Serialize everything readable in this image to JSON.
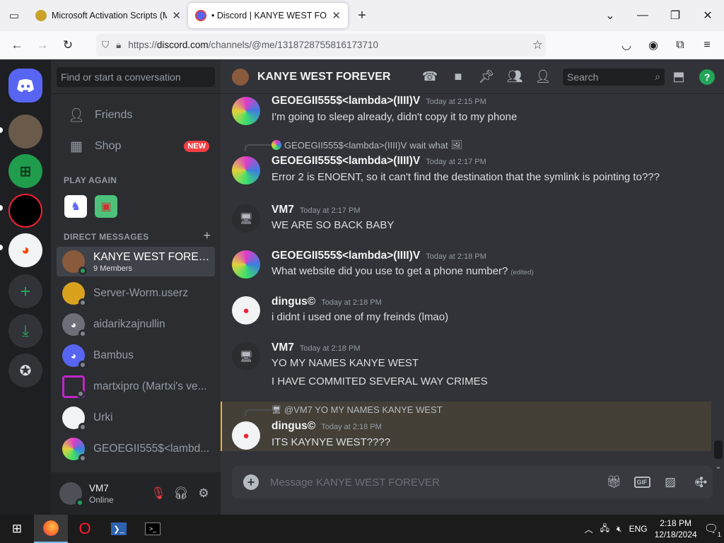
{
  "browser": {
    "tabs": [
      {
        "title": "Microsoft Activation Scripts (M",
        "active": false
      },
      {
        "title": "• Discord | KANYE WEST FOREV",
        "active": true
      }
    ],
    "new_tab": "+",
    "url_prefix": "https://",
    "url_host": "discord.com",
    "url_path": "/channels/@me/1318728755816173710"
  },
  "servers": {
    "items": [
      "discord-home",
      "avatar-1",
      "avatar-2",
      "avatar-3",
      "avatar-4"
    ],
    "add_label": "+",
    "download_label": "⤓",
    "discover_label": "⊘"
  },
  "dm_panel": {
    "search_placeholder": "Find or start a conversation",
    "friends_label": "Friends",
    "shop_label": "Shop",
    "shop_badge": "NEW",
    "play_again_label": "PLAY AGAIN",
    "direct_messages_label": "DIRECT MESSAGES",
    "add_dm": "+",
    "dms": [
      {
        "name": "KANYE WEST FOREV...",
        "sub": "9 Members",
        "selected": true,
        "status": "on",
        "color": "#8a5a3c"
      },
      {
        "name": "Server-Worm.userz",
        "sub": "",
        "selected": false,
        "status": "off",
        "color": "#d9a21e"
      },
      {
        "name": "aidarikzajnullin",
        "sub": "",
        "selected": false,
        "status": "off",
        "color": "#6d6f78"
      },
      {
        "name": "Bambus",
        "sub": "",
        "selected": false,
        "status": "off",
        "color": "#5865f2"
      },
      {
        "name": "martxipro (Martxi's ve...",
        "sub": "",
        "selected": false,
        "status": "off",
        "color": "#c026c9"
      },
      {
        "name": "Urki",
        "sub": "",
        "selected": false,
        "status": "off",
        "color": "#f2f3f5"
      },
      {
        "name": "GEOEGII555$<lambd...",
        "sub": "",
        "selected": false,
        "status": "off",
        "color": "#e03cc7"
      }
    ]
  },
  "user": {
    "name": "VM7",
    "status": "Online"
  },
  "chat": {
    "channel_name": "KANYE WEST FOREVER",
    "search_placeholder": "Search",
    "composer_placeholder": "Message KANYE WEST FOREVER",
    "messages": [
      {
        "author": "GEOEGII555$<lambda>(IIII)V",
        "time": "Today at 2:15 PM",
        "lines": [
          "I'm going to sleep already, didn't copy it to my phone"
        ]
      },
      {
        "reply_author": "GEOEGII555$<lambda>(IIII)V",
        "reply_text": "wait what",
        "author": "GEOEGII555$<lambda>(IIII)V",
        "time": "Today at 2:17 PM",
        "lines": [
          "Error 2 is ENOENT, so it can't find the destination that the symlink is pointing to???"
        ]
      },
      {
        "author": "VM7",
        "time": "Today at 2:17 PM",
        "lines": [
          "WE ARE SO BACK BABY"
        ]
      },
      {
        "author": "GEOEGII555$<lambda>(IIII)V",
        "time": "Today at 2:18 PM",
        "lines": [
          "What website did you use to get a phone number?"
        ],
        "edited": "(edited)"
      },
      {
        "author": "dingus©",
        "time": "Today at 2:18 PM",
        "lines": [
          "i didnt i used one of my freinds (lmao)"
        ]
      },
      {
        "author": "VM7",
        "time": "Today at 2:18 PM",
        "lines": [
          "YO MY NAMES KANYE WEST",
          "I HAVE COMMITED SEVERAL WAY CRIMES"
        ]
      },
      {
        "reply_text": "@VM7 YO MY NAMES KANYE WEST",
        "author": "dingus©",
        "time": "Today at 2:18 PM",
        "lines": [
          "ITS KAYNYE WEST????"
        ]
      }
    ]
  },
  "taskbar": {
    "lang": "ENG",
    "time": "2:18 PM",
    "date": "12/18/2024",
    "notif_count": "1"
  }
}
